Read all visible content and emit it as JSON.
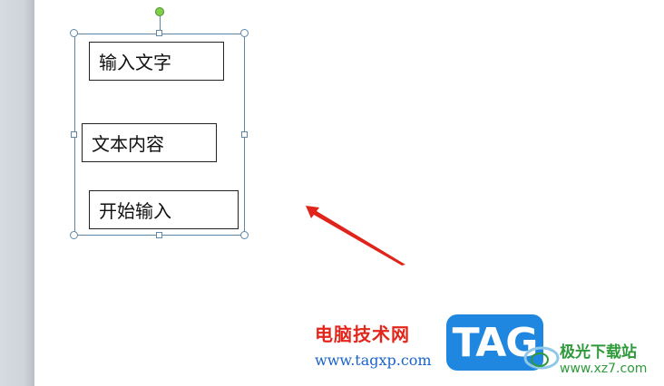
{
  "slide": {
    "text_boxes": [
      {
        "text": "输入文字"
      },
      {
        "text": "文本内容"
      },
      {
        "text": "开始输入"
      }
    ]
  },
  "annotation": {
    "arrow_color": "#e0241b"
  },
  "watermark": {
    "title": "电脑技术网",
    "url": "www.tagxp.com",
    "logo_text": "TAG",
    "site_name": "极光下载站",
    "site_url": "www.xz7.com"
  }
}
